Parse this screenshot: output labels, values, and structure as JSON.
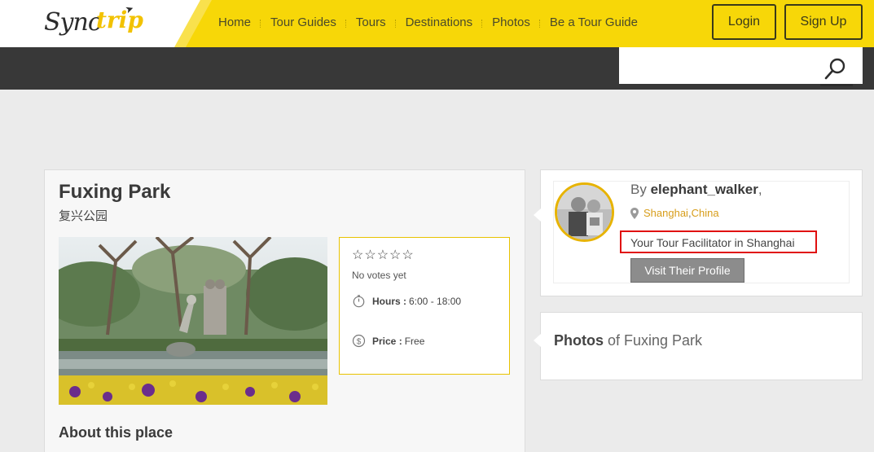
{
  "brand": {
    "logo_prefix": "Syno",
    "logo_suffix": "trip",
    "accent": "#f7d708"
  },
  "nav": {
    "items": [
      {
        "label": "Home"
      },
      {
        "label": "Tour Guides"
      },
      {
        "label": "Tours"
      },
      {
        "label": "Destinations"
      },
      {
        "label": "Photos"
      },
      {
        "label": "Be a Tour Guide"
      }
    ],
    "login_label": "Login",
    "signup_label": "Sign Up"
  },
  "search": {
    "placeholder": "",
    "value": "",
    "icon": "search-icon"
  },
  "place": {
    "title": "Fuxing Park",
    "subtitle": "复兴公园",
    "rating_stars": "☆☆☆☆☆",
    "votes_text": "No votes yet",
    "hours_label": "Hours :",
    "hours_value": "6:00 - 18:00",
    "price_label": "Price :",
    "price_value": "Free",
    "about_heading": "About this place"
  },
  "author": {
    "by_prefix": "By",
    "username": "elephant_walker",
    "username_suffix": ",",
    "city": "Shanghai",
    "location_separator": ", ",
    "country": "China",
    "tagline": "Your Tour Facilitator in Shanghai",
    "profile_button": "Visit Their Profile",
    "highlight_color": "#e01010"
  },
  "photos_section": {
    "title_strong": "Photos",
    "title_rest": " of Fuxing Park"
  }
}
